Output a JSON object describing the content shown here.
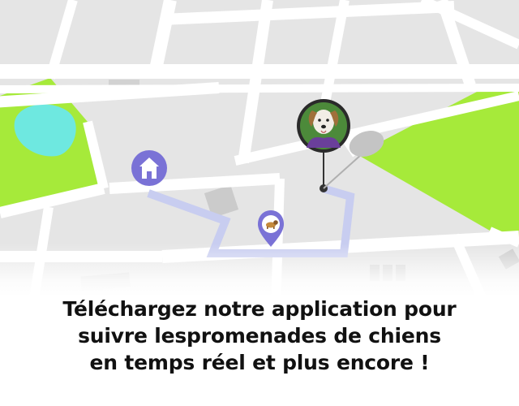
{
  "map": {
    "colors": {
      "block": "#e4e4e4",
      "street": "#ffffff",
      "park": "#a6ea3a",
      "water": "#6ee8e0",
      "building": "#cbcbcb",
      "route": "#c8cdf0",
      "marker": "#7a72d6"
    },
    "home_marker": {
      "icon": "home-icon"
    },
    "walk_marker": {
      "icon": "dog-icon"
    },
    "dog_avatar": {
      "icon": "dog-photo-icon"
    }
  },
  "caption": {
    "line1": "Téléchargez notre application pour",
    "line2": "suivre lespromenades de chiens",
    "line3": "en temps réel et plus encore !"
  }
}
